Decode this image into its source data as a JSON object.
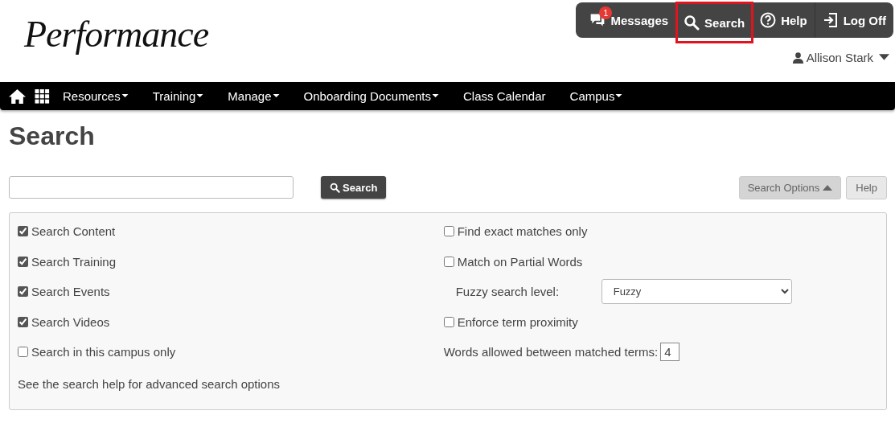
{
  "logo": {
    "text": "Performance"
  },
  "toolbar": [
    {
      "kind": "messages",
      "label": "Messages",
      "badge": "1",
      "selected": false
    },
    {
      "kind": "search",
      "label": "Search",
      "selected": true
    },
    {
      "kind": "help",
      "label": "Help",
      "selected": false
    },
    {
      "kind": "logoff",
      "label": "Log Off",
      "selected": false
    }
  ],
  "user": {
    "name": "Allison Stark"
  },
  "nav": [
    {
      "label": "Resources",
      "dropdown": true
    },
    {
      "label": "Training",
      "dropdown": true
    },
    {
      "label": "Manage",
      "dropdown": true
    },
    {
      "label": "Onboarding Documents",
      "dropdown": true
    },
    {
      "label": "Class Calendar",
      "dropdown": false
    },
    {
      "label": "Campus",
      "dropdown": true
    }
  ],
  "page_title": "Search",
  "search": {
    "button": "Search",
    "options_button": "Search Options",
    "options_expanded": true,
    "help_button": "Help"
  },
  "options_left": [
    {
      "kind": "checkbox",
      "label": "Search Content",
      "checked": true
    },
    {
      "kind": "checkbox",
      "label": "Search Training",
      "checked": true
    },
    {
      "kind": "checkbox",
      "label": "Search Events",
      "checked": true
    },
    {
      "kind": "checkbox",
      "label": "Search Videos",
      "checked": true
    },
    {
      "kind": "checkbox",
      "label": "Search in this campus only",
      "checked": false
    }
  ],
  "help_note": "See the search help for advanced search options",
  "options_right": [
    {
      "kind": "checkbox",
      "label": "Find exact matches only",
      "checked": false
    },
    {
      "kind": "checkbox",
      "label": "Match on Partial Words",
      "checked": false
    },
    {
      "kind": "select",
      "label": "Fuzzy search level:",
      "value": "Fuzzy"
    },
    {
      "kind": "checkbox",
      "label": "Enforce term proximity",
      "checked": false
    },
    {
      "kind": "number",
      "label": "Words allowed between matched terms:",
      "value": "4"
    }
  ]
}
